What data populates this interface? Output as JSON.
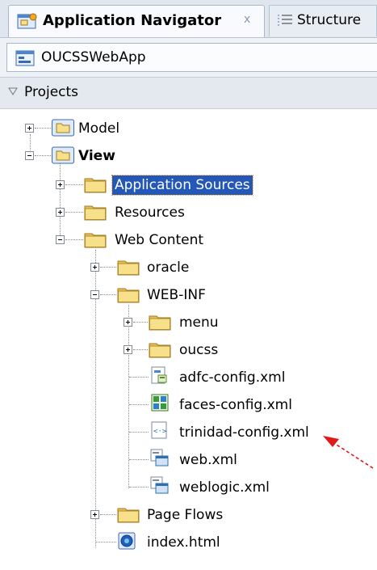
{
  "tabs": {
    "active": {
      "title": "Application Navigator",
      "close": "x",
      "icon": "application-navigator-icon"
    },
    "inactive": {
      "title": "Structure",
      "icon": "structure-icon"
    }
  },
  "application": {
    "name": "OUCSSWebApp",
    "icon": "application-icon"
  },
  "projects": {
    "label": "Projects",
    "icon": "collapse-triangle-icon"
  },
  "tree": {
    "model": {
      "label": "Model"
    },
    "view": {
      "label": "View"
    },
    "application_sources": {
      "label": "Application Sources"
    },
    "resources": {
      "label": "Resources"
    },
    "web_content": {
      "label": "Web Content"
    },
    "oracle": {
      "label": "oracle"
    },
    "web_inf": {
      "label": "WEB-INF"
    },
    "menu": {
      "label": "menu"
    },
    "oucss": {
      "label": "oucss"
    },
    "adfc_config": {
      "label": "adfc-config.xml"
    },
    "faces_config": {
      "label": "faces-config.xml"
    },
    "trinidad_config": {
      "label": "trinidad-config.xml"
    },
    "web_xml": {
      "label": "web.xml"
    },
    "weblogic_xml": {
      "label": "weblogic.xml"
    },
    "page_flows": {
      "label": "Page Flows"
    },
    "index_html": {
      "label": "index.html"
    }
  },
  "colors": {
    "selection": "#2458b8",
    "arrow": "#e0191b",
    "folder": "#f2d46a"
  }
}
